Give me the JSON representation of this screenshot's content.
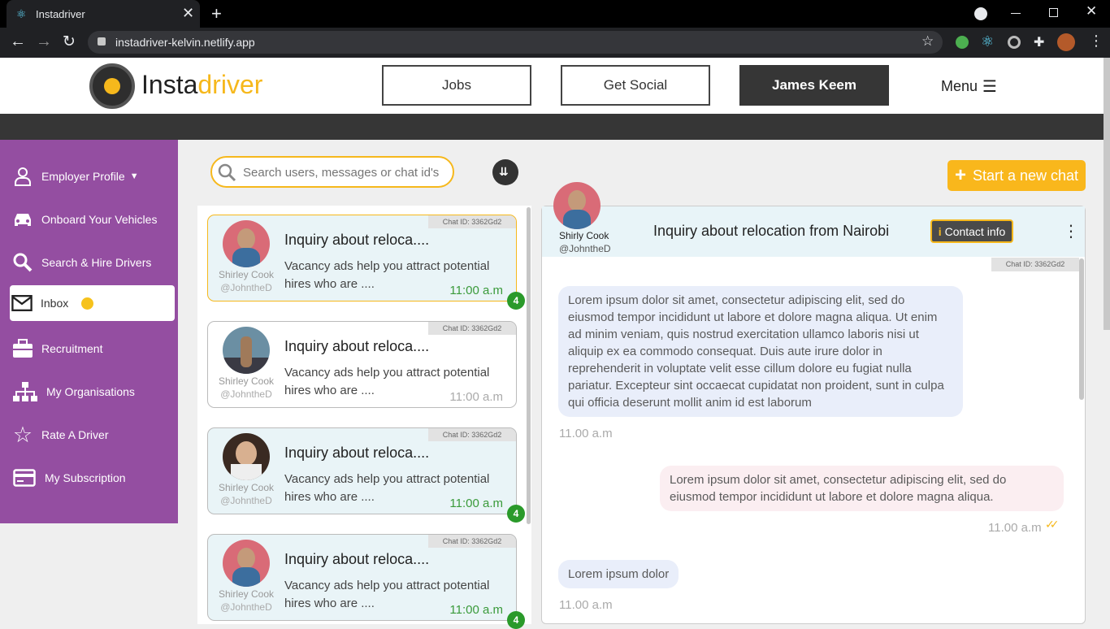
{
  "browser": {
    "tab_title": "Instadriver",
    "url": "instadriver-kelvin.netlify.app"
  },
  "site": {
    "brand_prefix": "Insta",
    "brand_suffix": "driver",
    "nav": {
      "jobs": "Jobs",
      "social": "Get Social",
      "user": "James Keem",
      "menu": "Menu"
    }
  },
  "sidebar": {
    "items": [
      {
        "label": "Employer Profile",
        "icon": "user-icon"
      },
      {
        "label": "Onboard Your Vehicles",
        "icon": "car-icon"
      },
      {
        "label": "Search & Hire Drivers",
        "icon": "search-icon"
      },
      {
        "label": "Inbox",
        "icon": "envelope-icon"
      },
      {
        "label": "Recruitment",
        "icon": "briefcase-icon"
      },
      {
        "label": "My Organisations",
        "icon": "org-chart-icon"
      },
      {
        "label": "Rate A Driver",
        "icon": "star-icon"
      },
      {
        "label": "My Subscription",
        "icon": "credit-card-icon"
      }
    ]
  },
  "search": {
    "placeholder": "Search users, messages or chat id's"
  },
  "chats": [
    {
      "chat_id": "Chat ID: 3362Gd2",
      "name": "Shirley Cook",
      "handle": "@JohntheD",
      "title": "Inquiry about reloca....",
      "preview": "Vacancy ads help you attract potential hires who are ....",
      "time": "11:00 a.m",
      "badge": "4"
    },
    {
      "chat_id": "Chat ID: 3362Gd2",
      "name": "Shirley Cook",
      "handle": "@JohntheD",
      "title": "Inquiry about reloca....",
      "preview": "Vacancy ads help you attract potential hires who are ....",
      "time": "11:00 a.m",
      "badge": ""
    },
    {
      "chat_id": "Chat ID: 3362Gd2",
      "name": "Shirley Cook",
      "handle": "@JohntheD",
      "title": "Inquiry about reloca....",
      "preview": "Vacancy ads help you attract potential hires who are ....",
      "time": "11:00 a.m",
      "badge": "4"
    },
    {
      "chat_id": "Chat ID: 3362Gd2",
      "name": "Shirley Cook",
      "handle": "@JohntheD",
      "title": "Inquiry about reloca....",
      "preview": "Vacancy ads help you attract potential hires who are ....",
      "time": "11:00 a.m",
      "badge": "4"
    }
  ],
  "conversation": {
    "new_chat": "Start a new chat",
    "name": "Shirly Cook",
    "handle": "@JohntheD",
    "title": "Inquiry about relocation from Nairobi",
    "contact_info": "Contact info",
    "chat_id": "Chat ID: 3362Gd2",
    "messages": [
      {
        "text": "Lorem ipsum dolor sit amet, consectetur adipiscing elit, sed do eiusmod tempor incididunt ut labore et dolore magna aliqua. Ut enim ad minim veniam, quis nostrud exercitation ullamco laboris nisi ut aliquip ex ea commodo consequat. Duis aute irure dolor in reprehenderit in voluptate velit esse cillum dolore eu fugiat nulla pariatur. Excepteur sint occaecat cupidatat non proident, sunt in culpa qui officia deserunt mollit anim id est laborum",
        "time": "11.00 a.m"
      },
      {
        "text": "Lorem ipsum dolor sit amet, consectetur adipiscing elit, sed do eiusmod tempor incididunt ut labore et dolore magna aliqua.",
        "time": "11.00 a.m"
      },
      {
        "text": "Lorem ipsum dolor",
        "time": "11.00 a.m"
      }
    ]
  },
  "colors": {
    "sidebar": "#944ea1",
    "accent": "#f9b71c",
    "unread": "#2a9a2a",
    "dark": "#363636"
  }
}
